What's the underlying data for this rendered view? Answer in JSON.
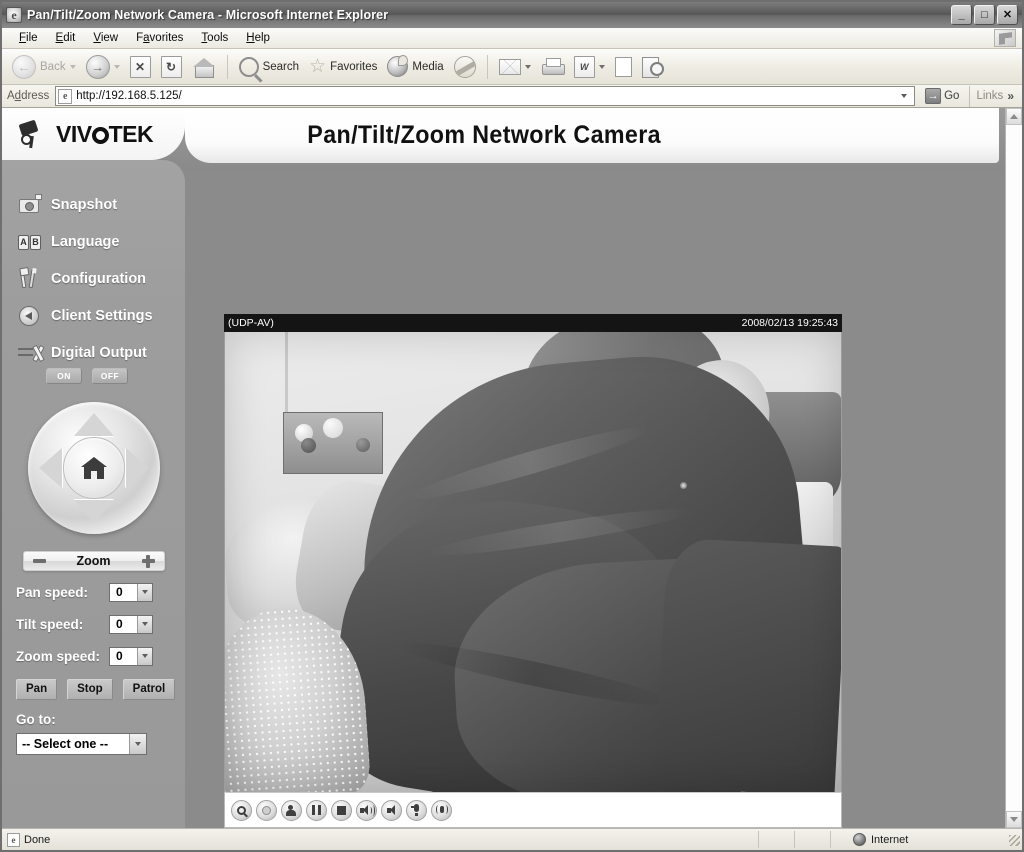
{
  "window": {
    "title": "Pan/Tilt/Zoom Network Camera - Microsoft Internet Explorer",
    "minimize_label": "_",
    "maximize_label": "□",
    "close_label": "✕"
  },
  "menubar": {
    "items": [
      {
        "label": "File",
        "accesskey": "F"
      },
      {
        "label": "Edit",
        "accesskey": "E"
      },
      {
        "label": "View",
        "accesskey": "V"
      },
      {
        "label": "Favorites",
        "accesskey": "a"
      },
      {
        "label": "Tools",
        "accesskey": "T"
      },
      {
        "label": "Help",
        "accesskey": "H"
      }
    ]
  },
  "toolbar": {
    "back_label": "Back",
    "search_label": "Search",
    "favorites_label": "Favorites",
    "media_label": "Media",
    "icons": [
      "back-icon",
      "forward-icon",
      "stop-icon",
      "refresh-icon",
      "home-icon",
      "search-icon",
      "favorites-star-icon",
      "media-icon",
      "history-icon",
      "mail-icon",
      "print-icon",
      "edit-word-icon",
      "blank-page-icon",
      "research-icon"
    ]
  },
  "address_bar": {
    "label": "Address",
    "url": "http://192.168.5.125/",
    "go_label": "Go",
    "links_label": "Links",
    "links_chevron": "»"
  },
  "page": {
    "header_title": "Pan/Tilt/Zoom Network Camera",
    "logo": {
      "text_before": "VIV",
      "text_after": "TEK",
      "icon": "camera-icon"
    },
    "sidebar": {
      "items": [
        {
          "label": "Snapshot",
          "icon": "snapshot-icon"
        },
        {
          "label": "Language",
          "icon": "language-icon"
        },
        {
          "label": "Configuration",
          "icon": "configuration-icon"
        },
        {
          "label": "Client Settings",
          "icon": "client-settings-icon"
        },
        {
          "label": "Digital Output",
          "icon": "digital-output-icon"
        }
      ],
      "digital_output": {
        "on_label": "ON",
        "off_label": "OFF"
      },
      "ptz": {
        "home_icon": "home-icon",
        "up_icon": "arrow-up-icon",
        "down_icon": "arrow-down-icon",
        "left_icon": "arrow-left-icon",
        "right_icon": "arrow-right-icon"
      },
      "zoom_bar": {
        "label": "Zoom",
        "minus_icon": "zoom-out-icon",
        "plus_icon": "zoom-in-icon"
      },
      "speeds": [
        {
          "label": "Pan speed:",
          "value": "0"
        },
        {
          "label": "Tilt speed:",
          "value": "0"
        },
        {
          "label": "Zoom speed:",
          "value": "0"
        }
      ],
      "actions": [
        {
          "label": "Pan"
        },
        {
          "label": "Stop"
        },
        {
          "label": "Patrol"
        }
      ],
      "goto": {
        "label": "Go to:",
        "selected": "-- Select one --"
      }
    },
    "video": {
      "stream_mode": "(UDP-AV)",
      "timestamp": "2008/02/13 19:25:43",
      "controls": [
        {
          "name": "digital-zoom-button",
          "icon": "magnifier-icon"
        },
        {
          "name": "record-button",
          "icon": "record-icon"
        },
        {
          "name": "snapshot-button",
          "icon": "snapshot-person-icon"
        },
        {
          "name": "pause-button",
          "icon": "pause-icon"
        },
        {
          "name": "stop-button",
          "icon": "stop-icon"
        },
        {
          "name": "volume-button",
          "icon": "speaker-on-icon"
        },
        {
          "name": "mute-button",
          "icon": "speaker-mute-icon"
        },
        {
          "name": "mic-button",
          "icon": "microphone-icon"
        },
        {
          "name": "talk-button",
          "icon": "talk-icon"
        }
      ]
    }
  },
  "statusbar": {
    "status_text": "Done",
    "zone_text": "Internet",
    "zone_icon": "globe-icon"
  }
}
